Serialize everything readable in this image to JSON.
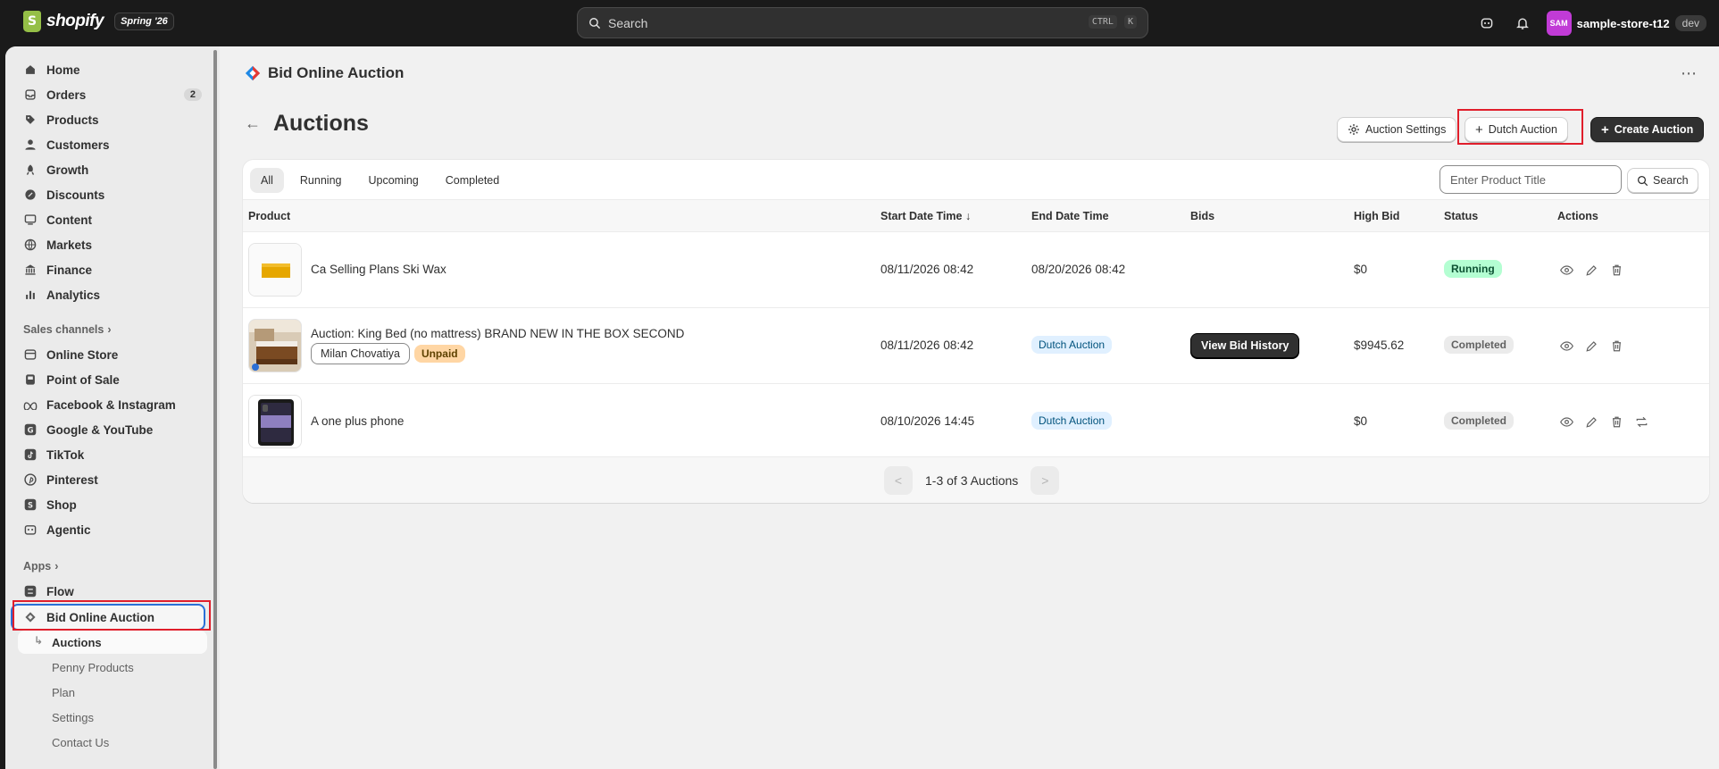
{
  "topbar": {
    "brand": "shopify",
    "season": "Spring '26",
    "search_placeholder": "Search",
    "kbd_ctrl": "CTRL",
    "kbd_k": "K",
    "store_initials": "SAM",
    "store_name": "sample-store-t12",
    "env_badge": "dev"
  },
  "sidebar": {
    "main_items": [
      {
        "label": "Home",
        "icon": "home-icon"
      },
      {
        "label": "Orders",
        "icon": "orders-icon",
        "count": "2"
      },
      {
        "label": "Products",
        "icon": "tag-icon"
      },
      {
        "label": "Customers",
        "icon": "person-icon"
      },
      {
        "label": "Growth",
        "icon": "growth-icon"
      },
      {
        "label": "Discounts",
        "icon": "discount-icon"
      },
      {
        "label": "Content",
        "icon": "content-icon"
      },
      {
        "label": "Markets",
        "icon": "globe-icon"
      },
      {
        "label": "Finance",
        "icon": "bank-icon"
      },
      {
        "label": "Analytics",
        "icon": "chart-icon"
      }
    ],
    "sales_channels_heading": "Sales channels",
    "sales_channels": [
      {
        "label": "Online Store",
        "icon": "store-icon"
      },
      {
        "label": "Point of Sale",
        "icon": "pos-icon"
      },
      {
        "label": "Facebook & Instagram",
        "icon": "meta-icon"
      },
      {
        "label": "Google & YouTube",
        "icon": "google-icon"
      },
      {
        "label": "TikTok",
        "icon": "tiktok-icon"
      },
      {
        "label": "Pinterest",
        "icon": "pinterest-icon"
      },
      {
        "label": "Shop",
        "icon": "shop-icon"
      },
      {
        "label": "Agentic",
        "icon": "agentic-icon"
      }
    ],
    "apps_heading": "Apps",
    "apps": [
      {
        "label": "Flow",
        "icon": "flow-icon"
      },
      {
        "label": "Bid Online Auction",
        "icon": "bid-app-icon"
      }
    ],
    "app_sub_items": [
      "Auctions",
      "Penny Products",
      "Plan",
      "Settings",
      "Contact Us"
    ]
  },
  "main": {
    "app_title": "Bid Online Auction",
    "page_title": "Auctions",
    "buttons": {
      "settings": "Auction Settings",
      "dutch": "Dutch Auction",
      "create": "Create Auction"
    },
    "tabs": [
      "All",
      "Running",
      "Upcoming",
      "Completed"
    ],
    "search_placeholder": "Enter Product Title",
    "search_button": "Search",
    "columns": [
      "Product",
      "Start Date Time",
      "End Date Time",
      "Bids",
      "High Bid",
      "Status",
      "Actions"
    ],
    "rows": [
      {
        "product": "Ca Selling Plans Ski Wax",
        "start": "08/11/2026 08:42",
        "end": "08/20/2026 08:42",
        "high_bid": "$0",
        "status": "Running"
      },
      {
        "product": "Auction: King Bed (no mattress) BRAND NEW IN THE BOX SECOND",
        "customer": "Milan Chovatiya",
        "payment": "Unpaid",
        "start": "08/11/2026 08:42",
        "end": "Dutch Auction",
        "bids": "View Bid History",
        "high_bid": "$9945.62",
        "status": "Completed"
      },
      {
        "product": "A one plus phone",
        "start": "08/10/2026 14:45",
        "end": "Dutch Auction",
        "high_bid": "$0",
        "status": "Completed"
      }
    ],
    "pagination": {
      "prev": "<",
      "label": "1-3 of 3 Auctions",
      "next": ">"
    }
  },
  "colors": {
    "accent_dark": "#303030",
    "running_bg": "#b4fed2",
    "highlight_red": "#e01e2b"
  }
}
